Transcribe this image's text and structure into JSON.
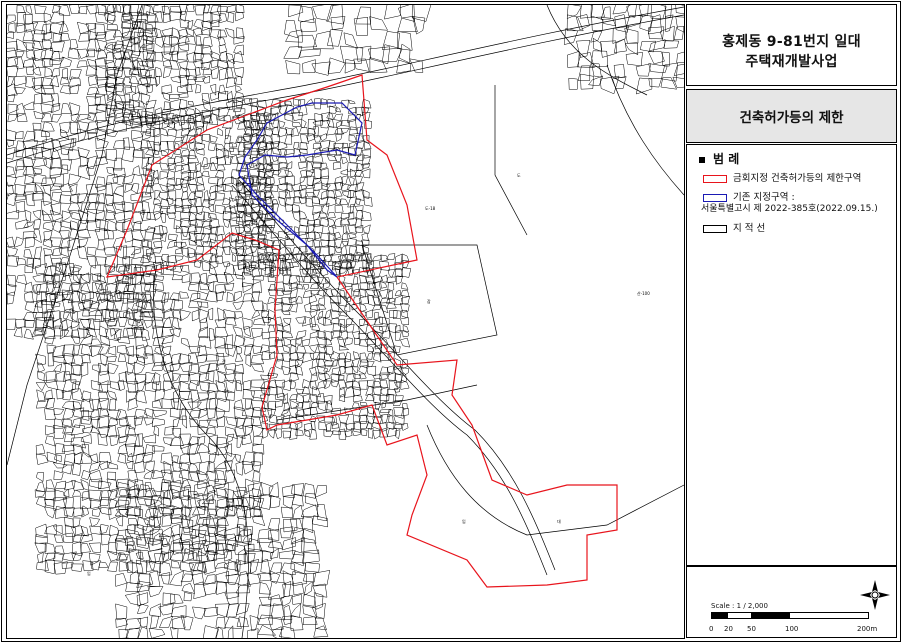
{
  "title": {
    "line1": "홍제동 9-81번지 일대",
    "line2": "주택재개발사업"
  },
  "subtitle": "건축허가등의 제한",
  "legend": {
    "heading": "범 례",
    "items": [
      {
        "label": "금회지정 건축허가등의 제한구역",
        "color": "#e8141c"
      },
      {
        "label": "기존 지정구역 :",
        "label2": "서울특별고시 제 2022-385호(2022.09.15.)",
        "color": "#1a1ab4"
      },
      {
        "label": "지 적 선",
        "color": "#000000"
      }
    ]
  },
  "scale": {
    "label": "Scale : 1 / 2,000",
    "ticks": [
      "0",
      "20",
      "50",
      "100",
      "200m"
    ]
  },
  "map_labels": {
    "a": "도-18",
    "b": "임",
    "c": "잡",
    "d": "대",
    "e": "도",
    "f": "전",
    "g": "임",
    "h": "산-100"
  },
  "colors": {
    "new_zone": "#e8141c",
    "existing_zone": "#1a1ab4",
    "cadastral": "#000000"
  }
}
